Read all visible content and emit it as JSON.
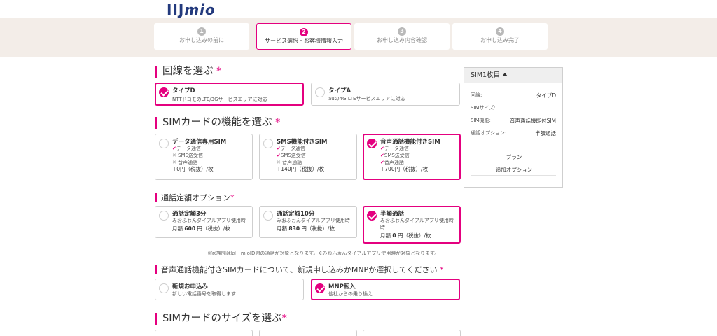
{
  "logo": {
    "main": "IIJ",
    "sub": "mio"
  },
  "steps": [
    {
      "num": "1",
      "label": "お申し込みの前に"
    },
    {
      "num": "2",
      "label": "サービス選択・お客様情報入力"
    },
    {
      "num": "3",
      "label": "お申し込み内容確認"
    },
    {
      "num": "4",
      "label": "お申し込み完了"
    }
  ],
  "required_mark": "*",
  "line": {
    "heading": "回線を選ぶ",
    "options": [
      {
        "title": "タイプD",
        "desc": "NTTドコモのLTE/3Gサービスエリアに対応"
      },
      {
        "title": "タイプA",
        "desc": "auの4G LTEサービスエリアに対応"
      }
    ]
  },
  "sim_function": {
    "heading": "SIMカードの機能を選ぶ",
    "options": [
      {
        "title": "データ通信専用SIM",
        "f1": "データ通信",
        "f2": "SMS送受信",
        "f3": "音声通話",
        "price": "+0円（税抜）/枚"
      },
      {
        "title": "SMS機能付きSIM",
        "f1": "データ通信",
        "f2": "SMS送受信",
        "f3": "音声通話",
        "price": "+140円（税抜）/枚"
      },
      {
        "title": "音声通話機能付きSIM",
        "f1": "データ通信",
        "f2": "SMS送受信",
        "f3": "音声通話",
        "price": "+700円（税抜）/枚"
      }
    ],
    "check": "✔",
    "cross": "✕"
  },
  "call_option": {
    "heading": "通話定額オプション",
    "options": [
      {
        "title": "通話定額3分",
        "desc": "みおふぉんダイアルアプリ使用時",
        "price_pre": "月額 ",
        "price_num": "600",
        "price_post": " 円（税抜）/枚"
      },
      {
        "title": "通話定額10分",
        "desc": "みおふぉんダイアルアプリ使用時",
        "price_pre": "月額 ",
        "price_num": "830",
        "price_post": " 円（税抜）/枚"
      },
      {
        "title": "半額通話",
        "desc1": "みおふぉんダイアルアプリ使用時",
        "desc2": "時",
        "price_pre": "月額 ",
        "price_num": "0",
        "price_post": " 円（税抜）/枚"
      }
    ],
    "note": "※家族間は同一mioID間の通話が対象となります。※みおふぉんダイアルアプリ使用時が対象となります。"
  },
  "mnp": {
    "heading": "音声通話機能付きSIMカードについて、新規申し込みかMNPか選択してください",
    "options": [
      {
        "title": "新規お申込み",
        "desc": "新しい電話番号を取得します"
      },
      {
        "title": "MNP転入",
        "desc": "他社からの乗り換え"
      }
    ]
  },
  "sim_size": {
    "heading": "SIMカードのサイズを選ぶ"
  },
  "sidebar": {
    "title": "SIM1枚目",
    "rows": [
      {
        "label": "回線:",
        "value": "タイプD"
      },
      {
        "label": "SIMサイズ:",
        "value": ""
      },
      {
        "label": "SIM機能:",
        "value": "音声通話機能付SIM"
      },
      {
        "label": "通話オプション:",
        "value": "半額通話"
      }
    ],
    "plan": "プラン",
    "addon": "追加オプション"
  },
  "colors": {
    "accent": "#e4007f",
    "step_bar_bg": "#f3ede8",
    "logo": "#233a7d"
  }
}
